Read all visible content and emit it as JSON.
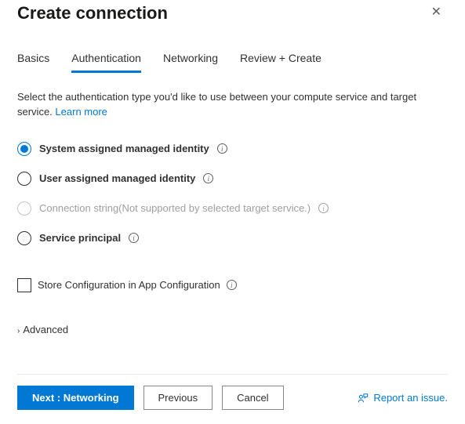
{
  "header": {
    "title": "Create connection"
  },
  "tabs": [
    {
      "label": "Basics",
      "active": false
    },
    {
      "label": "Authentication",
      "active": true
    },
    {
      "label": "Networking",
      "active": false
    },
    {
      "label": "Review + Create",
      "active": false
    }
  ],
  "description": "Select the authentication type you'd like to use between your compute service and target service.",
  "learn_more": "Learn more",
  "auth_options": [
    {
      "label": "System assigned managed identity",
      "selected": true,
      "disabled": false,
      "hint": ""
    },
    {
      "label": "User assigned managed identity",
      "selected": false,
      "disabled": false,
      "hint": ""
    },
    {
      "label": "Connection string",
      "selected": false,
      "disabled": true,
      "hint": "(Not supported by selected target service.)"
    },
    {
      "label": "Service principal",
      "selected": false,
      "disabled": false,
      "hint": ""
    }
  ],
  "store_config": {
    "label": "Store Configuration in App Configuration",
    "checked": false
  },
  "advanced_label": "Advanced",
  "footer": {
    "next": "Next : Networking",
    "previous": "Previous",
    "cancel": "Cancel",
    "report": "Report an issue."
  }
}
